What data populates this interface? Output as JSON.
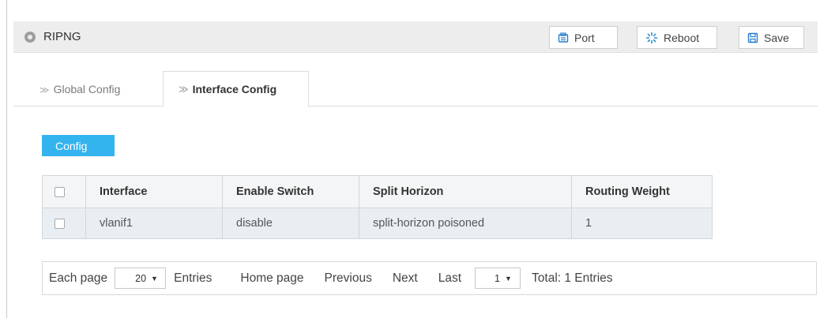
{
  "header": {
    "title": "RIPNG",
    "buttons": {
      "port": "Port",
      "reboot": "Reboot",
      "save": "Save"
    }
  },
  "tabs": [
    {
      "label": "Global Config",
      "active": false
    },
    {
      "label": "Interface Config",
      "active": true
    }
  ],
  "toolbar": {
    "config_label": "Config"
  },
  "table": {
    "columns": [
      "Interface",
      "Enable Switch",
      "Split Horizon",
      "Routing Weight"
    ],
    "rows": [
      {
        "interface": "vlanif1",
        "enable_switch": "disable",
        "split_horizon": "split-horizon poisoned",
        "routing_weight": "1",
        "checked": false
      }
    ]
  },
  "pager": {
    "each_page": "Each page",
    "page_size": "20",
    "entries": "Entries",
    "home": "Home page",
    "previous": "Previous",
    "next": "Next",
    "last": "Last",
    "current_page": "1",
    "total": "Total: 1 Entries"
  },
  "colors": {
    "accent": "#33b4ee",
    "header_bg": "#ededed",
    "row_bg": "#e9eef3"
  },
  "icons": {
    "title": "circle-dot-icon",
    "port": "port-icon",
    "reboot": "reboot-spinner-icon",
    "save": "floppy-disk-icon",
    "tab_chevron": "double-chevron-right-icon"
  }
}
